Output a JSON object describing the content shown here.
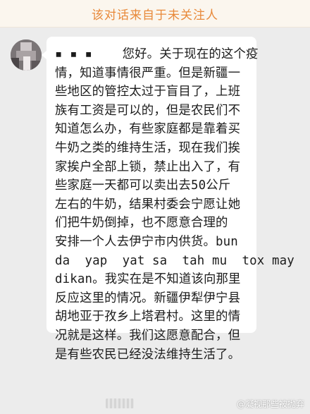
{
  "banner": {
    "text": "该对话来自于未关注人"
  },
  "avatar": {
    "icon": "avatar-mosaic-icon"
  },
  "message": {
    "lines": [
      "▪ ▪ ▪    您好。关于现在的这个疫",
      "情，知道事情很严重。但是新疆一",
      "些地区的管控太过于盲目了，上班",
      "族有工资是可以的，但是农民们不",
      "知道怎么办，有些家庭都是靠着买",
      "牛奶之类的维持生活，现在我们挨",
      "家挨户全部上锁，禁止出入了，有",
      "些家庭一天都可以卖出去50公斤",
      "左右的牛奶，结果村委会宁愿让她",
      "们把牛奶倒掉，也不愿意合理的",
      "安排一个人去伊宁市内供货。bun",
      "da  yap  yat sa  tah mu  tox may",
      "dikan。我实在是不知道该向那里",
      "反应这里的情况。新疆伊犁伊宁县",
      "胡地亚于孜乡上塔君村。这里的情",
      "况就是这样。我们这愿意配合，但",
      "是有些农民已经没法维持生活了。"
    ]
  },
  "watermark": {
    "text": "@凝视那些被抛弃"
  },
  "colors": {
    "background": "#ececec",
    "banner_bg": "#fbf6ee",
    "banner_text": "#e8893a",
    "bubble_bg": "#ffffff",
    "text": "#1c1c1c"
  }
}
